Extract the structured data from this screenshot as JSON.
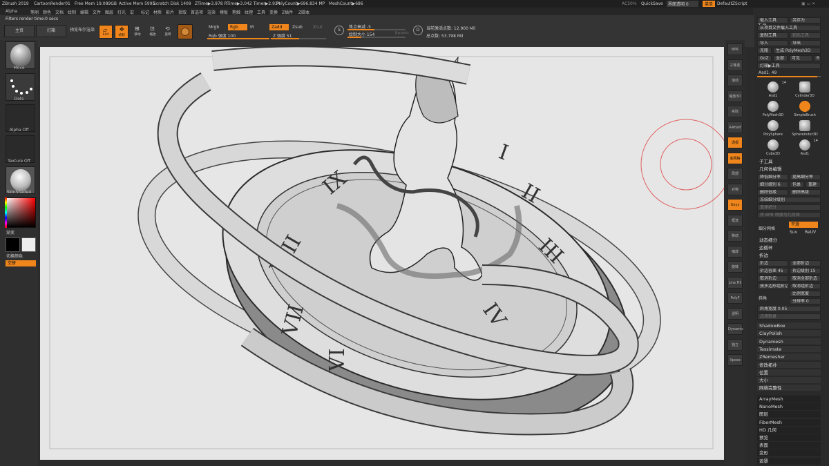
{
  "titlebar": {
    "app": "ZBrush 2019",
    "doc": "CartoonRender01",
    "free_mem": "Free Mem 19.089GB",
    "active_mem": "Active Mem 5995",
    "scratch": "Scratch Disk 1409",
    "ztime": "ZTime▶3.978 RTime▶3.042 Timer▶2.934",
    "poly": "PolyCount▶696.834 MP",
    "mesh": "MeshCount▶686",
    "ai": "AC50%",
    "quicksave": "QuickSave",
    "transparency": "界面透明 0",
    "menus_btn": "菜单",
    "script": "DefaultZScript"
  },
  "menubar": [
    "Alpha",
    "笔刷",
    "颜色",
    "文档",
    "绘制",
    "编辑",
    "文件",
    "图层",
    "灯光",
    "宏",
    "标记",
    "材质",
    "影片",
    "拾取",
    "首选项",
    "渲染",
    "模板",
    "笔触",
    "纹理",
    "工具",
    "变换",
    "Z插件",
    "Z脚本"
  ],
  "topbar": {
    "filter_info": "Filters render time:0 secs",
    "home": "主页",
    "lightbox": "灯箱",
    "bpr": "预览布尔渲染",
    "edit": "Edit",
    "draw": "绘制",
    "move": "移动",
    "scale": "缩放",
    "rotate": "旋转",
    "mrgb": "Mrgb",
    "rgb": "Rgb",
    "m": "M",
    "rgb_intensity": "Rgb 强度 100",
    "zadd": "Zadd",
    "zsub": "Zsub",
    "zcut": "Zcut",
    "z_intensity": "Z 强度 51",
    "focal": "焦点衰减 -5",
    "draw_size": "绘制大小 154",
    "dynamic": "Dynamic",
    "active_points": "当前激活点数: 12.900 Mil",
    "total_points": "总点数: 53.798 Mil",
    "rgb_intensity_value": 100,
    "z_intensity_value": 51
  },
  "leftshelf": {
    "brush": "Move",
    "stroke": "Dots",
    "alpha": "Alpha Off",
    "texture": "Texture Off",
    "material": "SkinShade4",
    "gradient": "渐变",
    "switch_color": "切换颜色",
    "alternate": "交替"
  },
  "rshelf": [
    "BPR",
    "子像素",
    "滚动",
    "缩放3D",
    "实际",
    "AAHalf",
    "透视",
    "底网格",
    "局部",
    "对称",
    "Gxyz",
    "框选",
    "移动",
    "缩放",
    "旋转",
    "Line Fill",
    "PolyF",
    "透明",
    "Dynamic",
    "独立",
    "Xpose"
  ],
  "tray": {
    "title": "工具",
    "load": "载入工具",
    "save_as": "另存为",
    "load_project": "从项目文件载入工具",
    "copy": "复制工具",
    "paste": "粘贴工具",
    "import": "导入",
    "export": "导出",
    "clone": "克隆",
    "make_polymesh": "生成 PolyMesh3D",
    "goz": "GoZ",
    "all": "全部",
    "visible": "可见",
    "r": "R",
    "lightbox_tools": "灯箱▶工具",
    "asd": "Asd1. 49",
    "tools": [
      {
        "name": "Asd1",
        "count": "14"
      },
      {
        "name": "Cylinder3D",
        "count": ""
      },
      {
        "name": "PolyMesh3D",
        "count": ""
      },
      {
        "name": "SimpleBrush",
        "count": ""
      },
      {
        "name": "PolySphere",
        "count": ""
      },
      {
        "name": "Sphereinder3D",
        "count": ""
      },
      {
        "name": "Cube3D",
        "count": ""
      },
      {
        "name": "Asd1",
        "count": "14"
      }
    ],
    "subtool": "子工具",
    "geometry": "几何体编辑",
    "lower_res": "降低细分率",
    "higher_res": "提高细分率",
    "sdiv": "细分级别 6",
    "cage": "包裹",
    "rebuild": "重建",
    "del_lower": "删除低级",
    "del_higher": "删除高级",
    "freeze": "冻结细分级别",
    "reconstruct": "重建细分",
    "bpr_convert": "将 BPR 转换为几何体",
    "divide": "细分网格",
    "smooth": "平滑",
    "suv": "Suv",
    "reuv": "ReUV",
    "dynamic_sub": "动态细分",
    "edgeloop": "边循环",
    "crease": "折边",
    "crease_btn": "折边",
    "crease_all": "全部折边",
    "crease_tol": "折边容差 45",
    "crease_lvl": "折边级别 15",
    "uncrease": "取消折边",
    "uncrease_all": "取消全部折边",
    "crease_pg": "按多边形组折边",
    "uncrease_pg": "取消组折边",
    "bevel": "斜角",
    "bevel_width": "比例宽度",
    "bevel_res": "分辨率 0",
    "bevel_amount": "斜角宽度 0.05",
    "edge_amount": "边缘数量",
    "sections": [
      "ShadowBox",
      "ClayPolish",
      "Dynamesh",
      "Tessimate",
      "ZRemesher",
      "修改拓扑",
      "位置",
      "大小",
      "网格完整性"
    ],
    "sections2": [
      "ArrayMesh",
      "NanoMesh",
      "图层",
      "FiberMesh",
      "HD 几何",
      "预览",
      "表面",
      "变形",
      "遮罩"
    ],
    "asd_value": 49
  },
  "colors": {
    "accent": "#f0861b",
    "bg": "#2b2b2b",
    "canvas": "#e6e6e6"
  }
}
